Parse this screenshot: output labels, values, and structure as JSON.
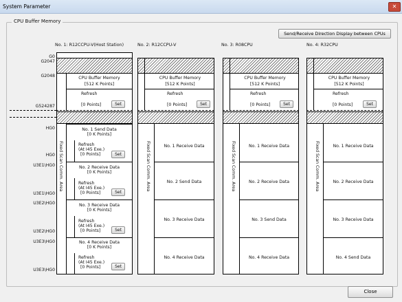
{
  "window": {
    "title": "System Parameter",
    "close_glyph": "✕"
  },
  "group_label": "CPU Buffer Memory",
  "direction_button": "Send/Receive Direction Display between CPUs",
  "close_button": "Close",
  "stations": [
    {
      "name": "No. 1: R12CCPU-V(Host Station)"
    },
    {
      "name": "No. 2: R12CCPU-V"
    },
    {
      "name": "No. 3: R08CPU"
    },
    {
      "name": "No. 4: R32CPU"
    }
  ],
  "address_labels": {
    "g0": "G0",
    "g2047": "G2047",
    "g2048": "G2048",
    "g524287": "G524287",
    "hg0a": "HG0",
    "hg0b": "HG0",
    "u3e1_start": "U3E1\\HG0",
    "u3e1_end": "U3E1\\HG0",
    "u3e2_start": "U3E2\\HG0",
    "u3e2_end": "U3E2\\HG0",
    "u3e3_start": "U3E3\\HG0",
    "u3e3_end": "U3E3\\HG0"
  },
  "buffer": {
    "title": "CPU Buffer Memory",
    "size": "[512 K Points]",
    "refresh": "Refresh",
    "refresh_points": "[0 Points]",
    "set": "Set"
  },
  "fixed_area_label": "Fixed Scan Comm. Area",
  "host_blocks": [
    {
      "title": "No. 1 Send Data",
      "points": "[0 K Points]",
      "refresh": "Refresh",
      "refresh_at": "(At I45 Exe.)",
      "refresh_points": "[0 Points]",
      "set": "Set"
    },
    {
      "title": "No. 2 Receive Data",
      "points": "[0 K Points]",
      "refresh": "Refresh",
      "refresh_at": "(At I45 Exe.)",
      "refresh_points": "[0 Points]",
      "set": "Set"
    },
    {
      "title": "No. 3 Receive Data",
      "points": "[0 K Points]",
      "refresh": "Refresh",
      "refresh_at": "(At I45 Exe.)",
      "refresh_points": "[0 Points]",
      "set": "Set"
    },
    {
      "title": "No. 4 Receive Data",
      "points": "[0 K Points]",
      "refresh": "Refresh",
      "refresh_at": "(At I45 Exe.)",
      "refresh_points": "[0 Points]",
      "set": "Set"
    }
  ],
  "other_blocks": [
    [
      "No. 1 Receive Data",
      "No. 2 Send Data",
      "No. 3 Receive Data",
      "No. 4 Receive Data"
    ],
    [
      "No. 1 Receive Data",
      "No. 2 Receive Data",
      "No. 3 Send Data",
      "No. 4 Receive Data"
    ],
    [
      "No. 1 Receive Data",
      "No. 2 Receive Data",
      "No. 3 Receive Data",
      "No. 4 Send Data"
    ]
  ]
}
